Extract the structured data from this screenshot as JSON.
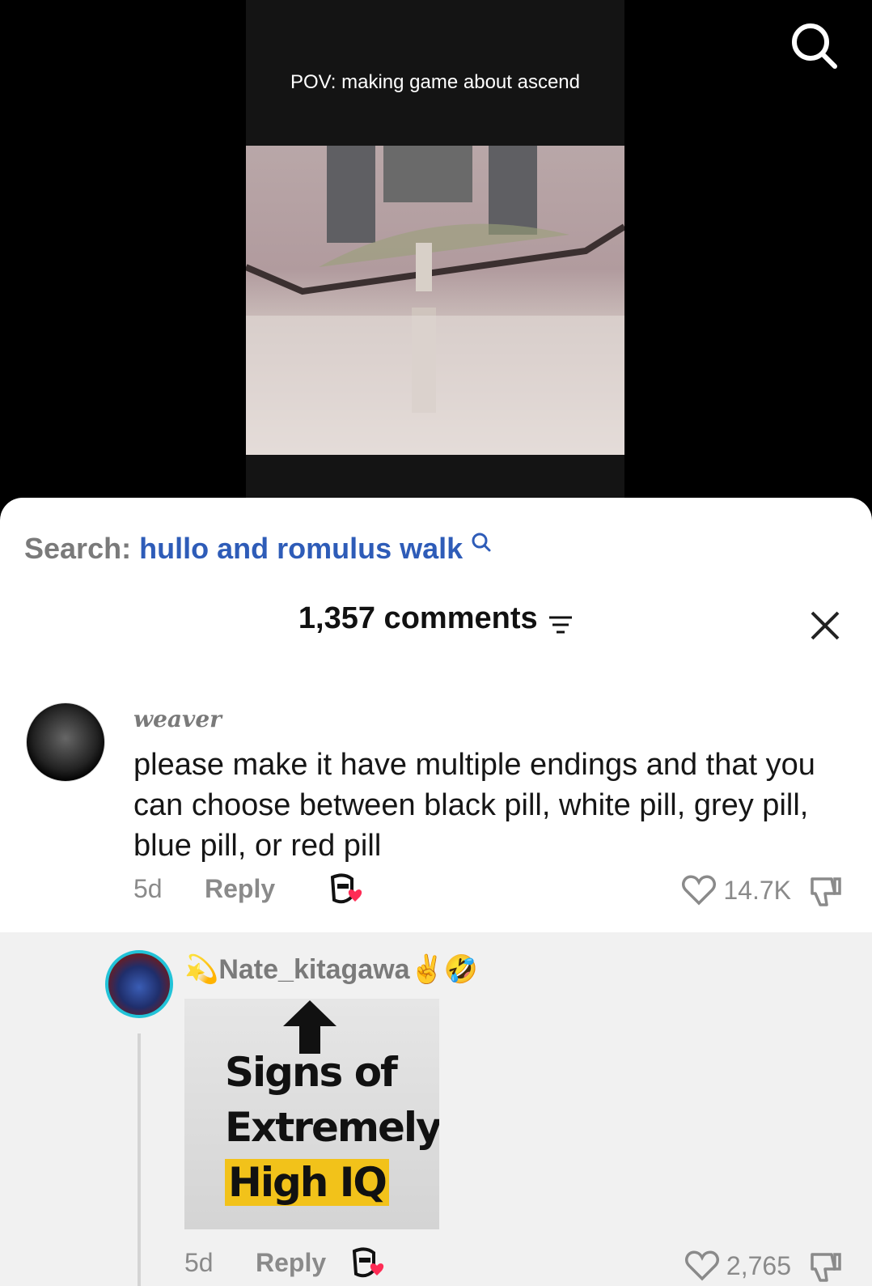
{
  "video": {
    "caption": "POV: making game about ascend"
  },
  "search": {
    "prefix": "Search:",
    "query": "hullo and romulus walk"
  },
  "comments_header": {
    "count": "1,357 comments"
  },
  "comment": {
    "username": "weaver",
    "text": "please make it have multiple endings and that you can choose between black pill, white pill, grey pill, blue pill, or red pill",
    "age": "5d",
    "reply_label": "Reply",
    "likes": "14.7K"
  },
  "reply": {
    "username_prefix_emoji": "💫",
    "username": "Nate_kitagawa",
    "username_suffix_emoji": "✌🤣",
    "image_lines": [
      "Signs of",
      "Extremely",
      "High IQ"
    ],
    "age": "5d",
    "reply_label": "Reply",
    "likes": "2,765"
  },
  "colors": {
    "link_blue": "#2e5cb8",
    "like_heart_red": "#fe2c55",
    "avatar_ring": "#22c3d8"
  }
}
